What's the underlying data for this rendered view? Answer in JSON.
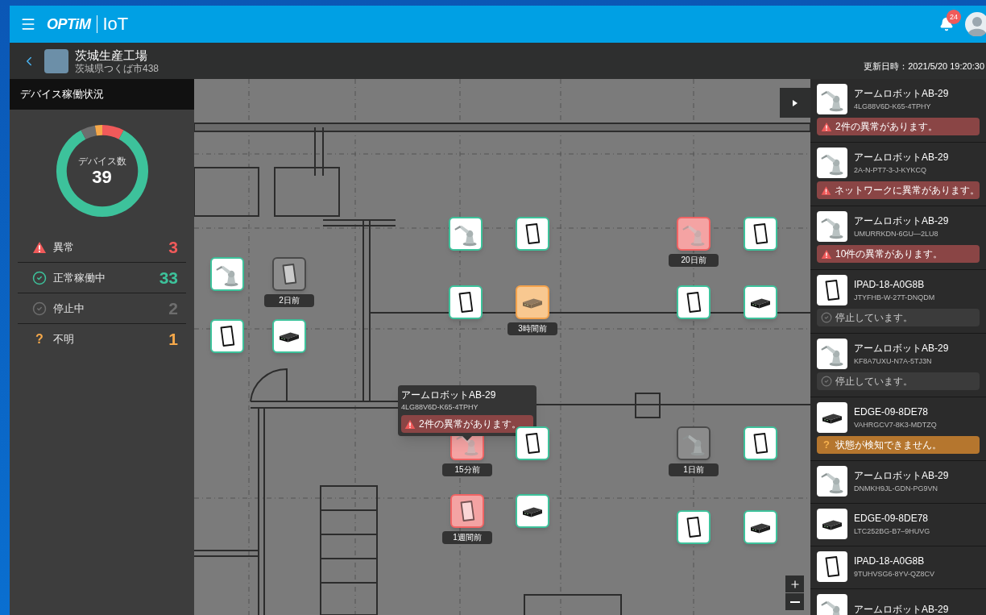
{
  "header": {
    "logo": {
      "brand": "OPTiM",
      "product": "IoT"
    },
    "notifications": {
      "count": "24"
    }
  },
  "site": {
    "name": "茨城生産工場",
    "address": "茨城県つくば市438",
    "updated": "更新日時：2021/5/20 19:20:30"
  },
  "status_panel": {
    "title": "デバイス稼働状況",
    "total_label": "デバイス数",
    "total": "39",
    "legend": [
      {
        "kind": "error",
        "label": "異常",
        "count": "3",
        "color": "#f05a5a"
      },
      {
        "kind": "normal",
        "label": "正常稼働中",
        "count": "33",
        "color": "#3dc29b"
      },
      {
        "kind": "stopped",
        "label": "停止中",
        "count": "2",
        "color": "#6e6e6e"
      },
      {
        "kind": "unknown",
        "label": "不明",
        "count": "1",
        "color": "#f5a84a",
        "symbol": "?"
      }
    ]
  },
  "map": {
    "markers": [
      {
        "kind": "robot",
        "status": {
          "kind": "normal"
        }
      },
      {
        "kind": "tablet",
        "status": {
          "kind": "normal"
        }
      },
      {
        "kind": "robot",
        "status": {
          "kind": "error"
        },
        "label": "20日前"
      },
      {
        "kind": "tablet",
        "status": {
          "kind": "normal"
        }
      },
      {
        "kind": "robot",
        "status": {
          "kind": "normal"
        }
      },
      {
        "kind": "tablet",
        "status": {
          "kind": "stopped"
        },
        "label": "2日前"
      },
      {
        "kind": "tablet",
        "status": {
          "kind": "normal"
        }
      },
      {
        "kind": "edge",
        "status": {
          "kind": "unknown"
        },
        "label": "3時間前"
      },
      {
        "kind": "tablet",
        "status": {
          "kind": "normal"
        }
      },
      {
        "kind": "edge",
        "status": {
          "kind": "normal"
        }
      },
      {
        "kind": "tablet",
        "status": {
          "kind": "normal"
        }
      },
      {
        "kind": "edge",
        "status": {
          "kind": "normal"
        }
      },
      {
        "kind": "robot",
        "status": {
          "kind": "error"
        },
        "label": "15分前",
        "tooltip": {
          "name": "アームロボットAB-29",
          "serial": "4LG88V6D-K65-4TPHY",
          "alert": "2件の異常があります。"
        }
      },
      {
        "kind": "tablet",
        "status": {
          "kind": "normal"
        }
      },
      {
        "kind": "robot",
        "status": {
          "kind": "stopped"
        },
        "label": "1日前"
      },
      {
        "kind": "tablet",
        "status": {
          "kind": "normal"
        }
      },
      {
        "kind": "tablet",
        "status": {
          "kind": "error"
        },
        "label": "1週間前"
      },
      {
        "kind": "edge",
        "status": {
          "kind": "normal"
        }
      },
      {
        "kind": "tablet",
        "status": {
          "kind": "normal"
        }
      },
      {
        "kind": "edge",
        "status": {
          "kind": "normal"
        }
      }
    ]
  },
  "device_list": [
    {
      "kind": "robot",
      "name": "アームロボットAB-29",
      "serial": "4LG88V6D-K65-4TPHY",
      "status": {
        "kind": "error",
        "text": "2件の異常があります。"
      }
    },
    {
      "kind": "robot",
      "name": "アームロボットAB-29",
      "serial": "2A-N-PT7-3-J-KYKCQ",
      "status": {
        "kind": "error",
        "text": "ネットワークに異常があります。"
      }
    },
    {
      "kind": "robot",
      "name": "アームロボットAB-29",
      "serial": "UMURRKDN-6GU—2LU8",
      "status": {
        "kind": "error",
        "text": "10件の異常があります。"
      }
    },
    {
      "kind": "tablet",
      "name": "IPAD-18-A0G8B",
      "serial": "JTYFHB-W-27T-DNQDM",
      "status": {
        "kind": "stopped",
        "text": "停止しています。"
      }
    },
    {
      "kind": "robot",
      "name": "アームロボットAB-29",
      "serial": "KF8A7UXU-N7A-5TJ3N",
      "status": {
        "kind": "stopped",
        "text": "停止しています。"
      }
    },
    {
      "kind": "edge",
      "name": "EDGE-09-8DE78",
      "serial": "VAHRGCV7-8K3-MDTZQ",
      "status": {
        "kind": "unknown",
        "text": "状態が検知できません。",
        "symbol": "?"
      }
    },
    {
      "kind": "robot",
      "name": "アームロボットAB-29",
      "serial": "DNMKH9JL-GDN-PG9VN"
    },
    {
      "kind": "edge",
      "name": "EDGE-09-8DE78",
      "serial": "LTC252BG-B7–9HUVG"
    },
    {
      "kind": "tablet",
      "name": "IPAD-18-A0G8B",
      "serial": "9TUHVSG6-8YV-QZ8CV"
    },
    {
      "kind": "robot",
      "name": "アームロボットAB-29"
    }
  ]
}
